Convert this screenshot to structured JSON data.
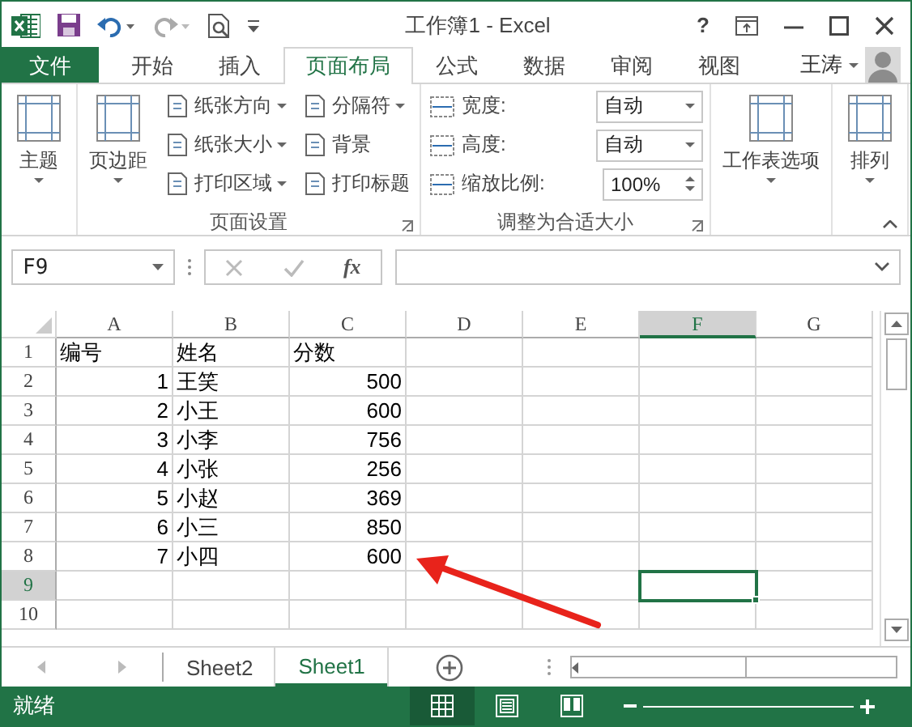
{
  "window": {
    "title": "工作簿1 - Excel"
  },
  "tabs": [
    {
      "label": "文件",
      "kind": "file",
      "selected": false
    },
    {
      "label": "开始",
      "kind": "tab",
      "selected": false
    },
    {
      "label": "插入",
      "kind": "tab",
      "selected": false
    },
    {
      "label": "页面布局",
      "kind": "tab",
      "selected": true
    },
    {
      "label": "公式",
      "kind": "tab",
      "selected": false
    },
    {
      "label": "数据",
      "kind": "tab",
      "selected": false
    },
    {
      "label": "审阅",
      "kind": "tab",
      "selected": false
    },
    {
      "label": "视图",
      "kind": "tab",
      "selected": false
    }
  ],
  "help": "?",
  "user": {
    "name": "王涛"
  },
  "ribbon": {
    "groups": [
      {
        "columns": [
          [
            {
              "kind": "big",
              "label": "主题",
              "dropdown": true
            }
          ]
        ]
      },
      {
        "label": "页面设置",
        "launcher": true,
        "columns": [
          [
            {
              "kind": "big",
              "label": "页边距",
              "dropdown": true
            }
          ],
          [
            {
              "kind": "small",
              "label": "纸张方向",
              "dropdown": true
            },
            {
              "kind": "small",
              "label": "纸张大小",
              "dropdown": true
            },
            {
              "kind": "small",
              "label": "打印区域",
              "dropdown": true
            }
          ],
          [
            {
              "kind": "small",
              "label": "分隔符",
              "dropdown": true
            },
            {
              "kind": "small",
              "label": "背景",
              "dropdown": false
            },
            {
              "kind": "small",
              "label": "打印标题",
              "dropdown": false
            }
          ]
        ]
      },
      {
        "label": "调整为合适大小",
        "launcher": true,
        "columns": [
          [
            {
              "kind": "combo",
              "label": "宽度:",
              "value": "自动"
            },
            {
              "kind": "combo",
              "label": "高度:",
              "value": "自动"
            },
            {
              "kind": "spin",
              "label": "缩放比例:",
              "value": "100%"
            }
          ]
        ]
      },
      {
        "columns": [
          [
            {
              "kind": "big",
              "label": "工作表选项",
              "dropdown": true
            }
          ]
        ]
      },
      {
        "columns": [
          [
            {
              "kind": "big",
              "label": "排列",
              "dropdown": true
            }
          ]
        ]
      }
    ]
  },
  "formula_bar": {
    "name_box": "F9",
    "function_label": "fx"
  },
  "sheet": {
    "columns": [
      {
        "label": "A",
        "selected": false
      },
      {
        "label": "B",
        "selected": false
      },
      {
        "label": "C",
        "selected": false
      },
      {
        "label": "D",
        "selected": false
      },
      {
        "label": "E",
        "selected": false
      },
      {
        "label": "F",
        "selected": true
      },
      {
        "label": "G",
        "selected": false
      }
    ],
    "rows": [
      {
        "number": "1",
        "selected": false,
        "cells": [
          {
            "text": "编号",
            "kind": "text"
          },
          {
            "text": "姓名",
            "kind": "text"
          },
          {
            "text": "分数",
            "kind": "text"
          }
        ]
      },
      {
        "number": "2",
        "selected": false,
        "cells": [
          {
            "text": "1",
            "kind": "number"
          },
          {
            "text": "王笑",
            "kind": "text"
          },
          {
            "text": "500",
            "kind": "number"
          }
        ]
      },
      {
        "number": "3",
        "selected": false,
        "cells": [
          {
            "text": "2",
            "kind": "number"
          },
          {
            "text": "小王",
            "kind": "text"
          },
          {
            "text": "600",
            "kind": "number"
          }
        ]
      },
      {
        "number": "4",
        "selected": false,
        "cells": [
          {
            "text": "3",
            "kind": "number"
          },
          {
            "text": "小李",
            "kind": "text"
          },
          {
            "text": "756",
            "kind": "number"
          }
        ]
      },
      {
        "number": "5",
        "selected": false,
        "cells": [
          {
            "text": "4",
            "kind": "number"
          },
          {
            "text": "小张",
            "kind": "text"
          },
          {
            "text": "256",
            "kind": "number"
          }
        ]
      },
      {
        "number": "6",
        "selected": false,
        "cells": [
          {
            "text": "5",
            "kind": "number"
          },
          {
            "text": "小赵",
            "kind": "text"
          },
          {
            "text": "369",
            "kind": "number"
          }
        ]
      },
      {
        "number": "7",
        "selected": false,
        "cells": [
          {
            "text": "6",
            "kind": "number"
          },
          {
            "text": "小三",
            "kind": "text"
          },
          {
            "text": "850",
            "kind": "number"
          }
        ]
      },
      {
        "number": "8",
        "selected": false,
        "cells": [
          {
            "text": "7",
            "kind": "number"
          },
          {
            "text": "小四",
            "kind": "text"
          },
          {
            "text": "600",
            "kind": "number"
          }
        ]
      },
      {
        "number": "9",
        "selected": true,
        "cells": []
      },
      {
        "number": "10",
        "selected": false,
        "cells": []
      }
    ]
  },
  "sheet_tabs": [
    {
      "label": "Sheet2",
      "selected": false
    },
    {
      "label": "Sheet1",
      "selected": true
    }
  ],
  "status_bar": {
    "text": "就绪",
    "views": [
      {
        "kind": "normal",
        "selected": true
      },
      {
        "kind": "layout",
        "selected": false
      },
      {
        "kind": "break",
        "selected": false
      }
    ]
  }
}
